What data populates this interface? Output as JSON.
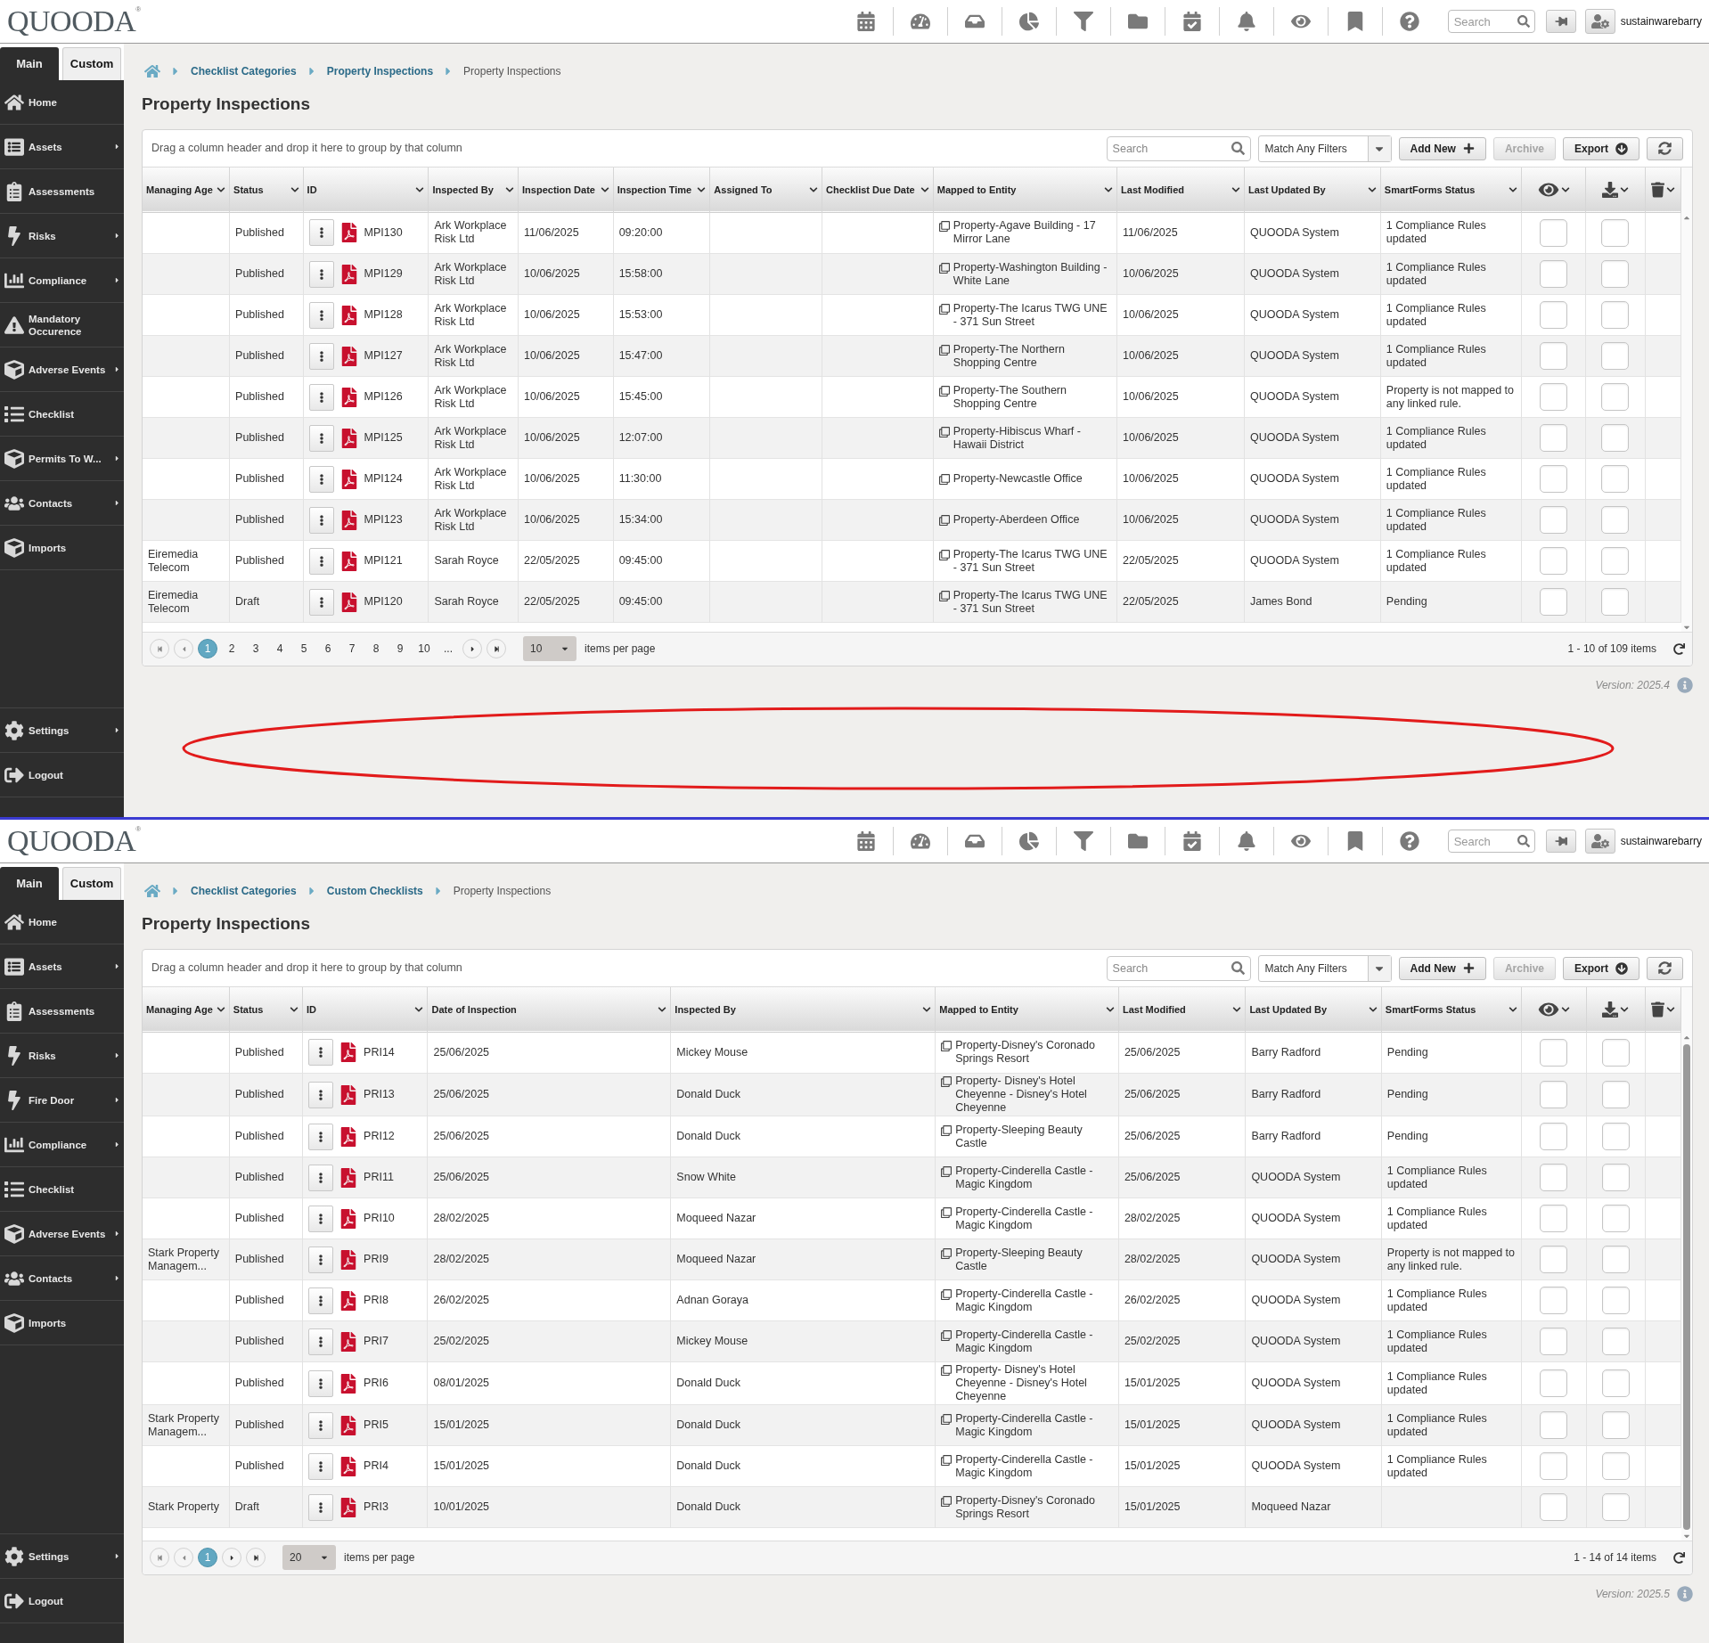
{
  "screens": [
    {
      "logo": "QUOODA",
      "logo_mark": "®",
      "top_search": {
        "placeholder": "Search"
      },
      "username": "sustainwarebarry",
      "sidebar_tabs": [
        {
          "label": "Main",
          "selected": true
        },
        {
          "label": "Custom",
          "selected": false
        }
      ],
      "menu": [
        {
          "label": "Home",
          "kind": "home",
          "submenu": false
        },
        {
          "label": "Assets",
          "kind": "card",
          "submenu": true
        },
        {
          "label": "Assessments",
          "kind": "clipboard",
          "submenu": false
        },
        {
          "label": "Risks",
          "kind": "bolt",
          "submenu": true
        },
        {
          "label": "Compliance",
          "kind": "chart",
          "submenu": true
        },
        {
          "label": "Mandatory Occurence",
          "kind": "warning",
          "submenu": false
        },
        {
          "label": "Adverse Events",
          "kind": "box",
          "submenu": true
        },
        {
          "label": "Checklist",
          "kind": "list",
          "submenu": false
        },
        {
          "label": "Permits To W...",
          "kind": "box",
          "submenu": true
        },
        {
          "label": "Contacts",
          "kind": "people",
          "submenu": true
        },
        {
          "label": "Imports",
          "kind": "box",
          "submenu": false
        }
      ],
      "bottom_menu": [
        {
          "label": "Settings",
          "kind": "gear",
          "submenu": true
        },
        {
          "label": "Logout",
          "kind": "exit",
          "submenu": false
        }
      ],
      "breadcrumb": [
        {
          "label": "Checklist Categories",
          "current": false
        },
        {
          "label": "Property Inspections",
          "current": false
        },
        {
          "label": "Property Inspections",
          "current": true
        }
      ],
      "title": "Property Inspections",
      "group_hint": "Drag a column header and drop it here to group by that column",
      "grid_search": {
        "placeholder": "Search"
      },
      "filter_select": {
        "value": "Match Any Filters"
      },
      "buttons": [
        {
          "label": "Add New",
          "kind": "add",
          "disabled": false
        },
        {
          "label": "Archive",
          "kind": "archive",
          "disabled": true
        },
        {
          "label": "Export",
          "kind": "export",
          "disabled": false
        },
        {
          "kind": "refresh",
          "disabled": false
        }
      ],
      "columns": [
        {
          "label": "Managing Age",
          "kind": "text"
        },
        {
          "label": "Status",
          "kind": "text"
        },
        {
          "label": "ID",
          "kind": "id"
        },
        {
          "label": "Inspected By",
          "kind": "text"
        },
        {
          "label": "Inspection Date",
          "kind": "text"
        },
        {
          "label": "Inspection Time",
          "kind": "text"
        },
        {
          "label": "Assigned To",
          "kind": "text"
        },
        {
          "label": "Checklist Due Date",
          "kind": "text"
        },
        {
          "label": "Mapped to Entity",
          "kind": "entity"
        },
        {
          "label": "Last Modified",
          "kind": "text"
        },
        {
          "label": "Last Updated By",
          "kind": "text"
        },
        {
          "label": "SmartForms Status",
          "kind": "text"
        },
        {
          "kind": "view"
        },
        {
          "kind": "download"
        },
        {
          "kind": "delete"
        }
      ],
      "rows": [
        {
          "status": "Published",
          "id": "MPI130",
          "inspected_by": "Ark Workplace Risk Ltd",
          "inspection_date": "11/06/2025",
          "inspection_time": "09:20:00",
          "mapped_to_entity": "Property-Agave Building - 17 Mirror Lane",
          "last_modified": "11/06/2025",
          "last_updated_by": "QUOODA System",
          "smartforms_status": "1 Compliance Rules updated",
          "view_checked": false,
          "download_checked": false
        },
        {
          "status": "Published",
          "id": "MPI129",
          "inspected_by": "Ark Workplace Risk Ltd",
          "inspection_date": "10/06/2025",
          "inspection_time": "15:58:00",
          "mapped_to_entity": "Property-Washington Building - White Lane",
          "last_modified": "10/06/2025",
          "last_updated_by": "QUOODA System",
          "smartforms_status": "1 Compliance Rules updated",
          "view_checked": false,
          "download_checked": false
        },
        {
          "status": "Published",
          "id": "MPI128",
          "inspected_by": "Ark Workplace Risk Ltd",
          "inspection_date": "10/06/2025",
          "inspection_time": "15:53:00",
          "mapped_to_entity": "Property-The Icarus TWG UNE - 371 Sun Street",
          "last_modified": "10/06/2025",
          "last_updated_by": "QUOODA System",
          "smartforms_status": "1 Compliance Rules updated",
          "view_checked": false,
          "download_checked": false
        },
        {
          "status": "Published",
          "id": "MPI127",
          "inspected_by": "Ark Workplace Risk Ltd",
          "inspection_date": "10/06/2025",
          "inspection_time": "15:47:00",
          "mapped_to_entity": "Property-The Northern Shopping Centre",
          "last_modified": "10/06/2025",
          "last_updated_by": "QUOODA System",
          "smartforms_status": "1 Compliance Rules updated",
          "view_checked": false,
          "download_checked": false
        },
        {
          "status": "Published",
          "id": "MPI126",
          "inspected_by": "Ark Workplace Risk Ltd",
          "inspection_date": "10/06/2025",
          "inspection_time": "15:45:00",
          "mapped_to_entity": "Property-The Southern Shopping Centre",
          "last_modified": "10/06/2025",
          "last_updated_by": "QUOODA System",
          "smartforms_status": "Property is not mapped to any linked rule.",
          "view_checked": false,
          "download_checked": false
        },
        {
          "status": "Published",
          "id": "MPI125",
          "inspected_by": "Ark Workplace Risk Ltd",
          "inspection_date": "10/06/2025",
          "inspection_time": "12:07:00",
          "mapped_to_entity": "Property-Hibiscus Wharf - Hawaii District",
          "last_modified": "10/06/2025",
          "last_updated_by": "QUOODA System",
          "smartforms_status": "1 Compliance Rules updated",
          "view_checked": false,
          "download_checked": false
        },
        {
          "status": "Published",
          "id": "MPI124",
          "inspected_by": "Ark Workplace Risk Ltd",
          "inspection_date": "10/06/2025",
          "inspection_time": "11:30:00",
          "mapped_to_entity": "Property-Newcastle Office",
          "last_modified": "10/06/2025",
          "last_updated_by": "QUOODA System",
          "smartforms_status": "1 Compliance Rules updated",
          "view_checked": false,
          "download_checked": false
        },
        {
          "status": "Published",
          "id": "MPI123",
          "inspected_by": "Ark Workplace Risk Ltd",
          "inspection_date": "10/06/2025",
          "inspection_time": "15:34:00",
          "mapped_to_entity": "Property-Aberdeen Office",
          "last_modified": "10/06/2025",
          "last_updated_by": "QUOODA System",
          "smartforms_status": "1 Compliance Rules updated",
          "view_checked": false,
          "download_checked": false
        },
        {
          "managing_agent": "Eiremedia Telecom",
          "status": "Published",
          "id": "MPI121",
          "inspected_by": "Sarah Royce",
          "inspection_date": "22/05/2025",
          "inspection_time": "09:45:00",
          "mapped_to_entity": "Property-The Icarus TWG UNE - 371 Sun Street",
          "last_modified": "22/05/2025",
          "last_updated_by": "QUOODA System",
          "smartforms_status": "1 Compliance Rules updated",
          "view_checked": false,
          "download_checked": false
        },
        {
          "managing_agent": "Eiremedia Telecom",
          "status": "Draft",
          "id": "MPI120",
          "inspected_by": "Sarah Royce",
          "inspection_date": "22/05/2025",
          "inspection_time": "09:45:00",
          "mapped_to_entity": "Property-The Icarus TWG UNE - 371 Sun Street",
          "last_modified": "22/05/2025",
          "last_updated_by": "James Bond",
          "smartforms_status": "Pending",
          "view_checked": false,
          "download_checked": false
        }
      ],
      "pager": {
        "pages": [
          {
            "label": "1",
            "selected": true
          },
          {
            "label": "2",
            "selected": false
          },
          {
            "label": "3",
            "selected": false
          },
          {
            "label": "4",
            "selected": false
          },
          {
            "label": "5",
            "selected": false
          },
          {
            "label": "6",
            "selected": false
          },
          {
            "label": "7",
            "selected": false
          },
          {
            "label": "8",
            "selected": false
          },
          {
            "label": "9",
            "selected": false
          },
          {
            "label": "10",
            "selected": false
          },
          {
            "label": "...",
            "selected": false
          }
        ],
        "page_size": "10",
        "page_size_label": "items per page",
        "summary": "1 - 10 of 109 items"
      },
      "version": "Version: 2025.4",
      "annotation": {
        "kind": "ellipse"
      }
    },
    {
      "logo": "QUOODA",
      "logo_mark": "®",
      "top_search": {
        "placeholder": "Search"
      },
      "username": "sustainwarebarry",
      "sidebar_tabs": [
        {
          "label": "Main",
          "selected": true
        },
        {
          "label": "Custom",
          "selected": false
        }
      ],
      "menu": [
        {
          "label": "Home",
          "kind": "home",
          "submenu": false
        },
        {
          "label": "Assets",
          "kind": "card",
          "submenu": true
        },
        {
          "label": "Assessments",
          "kind": "clipboard",
          "submenu": false
        },
        {
          "label": "Risks",
          "kind": "bolt",
          "submenu": true
        },
        {
          "label": "Fire Door",
          "kind": "bolt",
          "submenu": true
        },
        {
          "label": "Compliance",
          "kind": "chart",
          "submenu": true
        },
        {
          "label": "Checklist",
          "kind": "list",
          "submenu": false
        },
        {
          "label": "Adverse Events",
          "kind": "box",
          "submenu": true
        },
        {
          "label": "Contacts",
          "kind": "people",
          "submenu": true
        },
        {
          "label": "Imports",
          "kind": "box",
          "submenu": false
        }
      ],
      "bottom_menu": [
        {
          "label": "Settings",
          "kind": "gear",
          "submenu": true
        },
        {
          "label": "Logout",
          "kind": "exit",
          "submenu": false
        }
      ],
      "breadcrumb": [
        {
          "label": "Checklist Categories",
          "current": false
        },
        {
          "label": "Custom Checklists",
          "current": false
        },
        {
          "label": "Property Inspections",
          "current": true
        }
      ],
      "title": "Property Inspections",
      "group_hint": "Drag a column header and drop it here to group by that column",
      "grid_search": {
        "placeholder": "Search"
      },
      "filter_select": {
        "value": "Match Any Filters"
      },
      "buttons": [
        {
          "label": "Add New",
          "kind": "add",
          "disabled": false
        },
        {
          "label": "Archive",
          "kind": "archive",
          "disabled": true
        },
        {
          "label": "Export",
          "kind": "export",
          "disabled": false
        },
        {
          "kind": "refresh",
          "disabled": false
        }
      ],
      "columns": [
        {
          "label": "Managing Age",
          "kind": "text"
        },
        {
          "label": "Status",
          "kind": "text"
        },
        {
          "label": "ID",
          "kind": "id"
        },
        {
          "label": "Date of Inspection",
          "kind": "text"
        },
        {
          "label": "Inspected By",
          "kind": "text"
        },
        {
          "label": "Mapped to Entity",
          "kind": "entity"
        },
        {
          "label": "Last Modified",
          "kind": "text"
        },
        {
          "label": "Last Updated By",
          "kind": "text"
        },
        {
          "label": "SmartForms Status",
          "kind": "text"
        },
        {
          "kind": "view"
        },
        {
          "kind": "download"
        },
        {
          "kind": "delete"
        }
      ],
      "rows": [
        {
          "status": "Published",
          "id": "PRI14",
          "date_of_inspection": "25/06/2025",
          "inspected_by": "Mickey Mouse",
          "mapped_to_entity": "Property-Disney's Coronado Springs Resort",
          "last_modified": "25/06/2025",
          "last_updated_by": "Barry Radford",
          "smartforms_status": "Pending",
          "view_checked": false,
          "download_checked": false
        },
        {
          "status": "Published",
          "id": "PRI13",
          "date_of_inspection": "25/06/2025",
          "inspected_by": "Donald Duck",
          "mapped_to_entity": "Property- Disney's Hotel Cheyenne - Disney's Hotel Cheyenne",
          "last_modified": "25/06/2025",
          "last_updated_by": "Barry Radford",
          "smartforms_status": "Pending",
          "view_checked": false,
          "download_checked": false
        },
        {
          "status": "Published",
          "id": "PRI12",
          "date_of_inspection": "25/06/2025",
          "inspected_by": "Donald Duck",
          "mapped_to_entity": "Property-Sleeping Beauty Castle",
          "last_modified": "25/06/2025",
          "last_updated_by": "Barry Radford",
          "smartforms_status": "Pending",
          "view_checked": false,
          "download_checked": false
        },
        {
          "status": "Published",
          "id": "PRI11",
          "date_of_inspection": "25/06/2025",
          "inspected_by": "Snow White",
          "mapped_to_entity": "Property-Cinderella Castle - Magic Kingdom",
          "last_modified": "25/06/2025",
          "last_updated_by": "QUOODA System",
          "smartforms_status": "1 Compliance Rules updated",
          "view_checked": false,
          "download_checked": false
        },
        {
          "status": "Published",
          "id": "PRI10",
          "date_of_inspection": "28/02/2025",
          "inspected_by": "Moqueed Nazar",
          "mapped_to_entity": "Property-Cinderella Castle - Magic Kingdom",
          "last_modified": "28/02/2025",
          "last_updated_by": "QUOODA System",
          "smartforms_status": "1 Compliance Rules updated",
          "view_checked": false,
          "download_checked": false
        },
        {
          "managing_agent": "Stark Property Managem...",
          "status": "Published",
          "id": "PRI9",
          "date_of_inspection": "28/02/2025",
          "inspected_by": "Moqueed Nazar",
          "mapped_to_entity": "Property-Sleeping Beauty Castle",
          "last_modified": "28/02/2025",
          "last_updated_by": "QUOODA System",
          "smartforms_status": "Property is not mapped to any linked rule.",
          "view_checked": false,
          "download_checked": false
        },
        {
          "status": "Published",
          "id": "PRI8",
          "date_of_inspection": "26/02/2025",
          "inspected_by": "Adnan Goraya",
          "mapped_to_entity": "Property-Cinderella Castle - Magic Kingdom",
          "last_modified": "26/02/2025",
          "last_updated_by": "QUOODA System",
          "smartforms_status": "1 Compliance Rules updated",
          "view_checked": false,
          "download_checked": false
        },
        {
          "status": "Published",
          "id": "PRI7",
          "date_of_inspection": "25/02/2025",
          "inspected_by": "Mickey Mouse",
          "mapped_to_entity": "Property-Cinderella Castle - Magic Kingdom",
          "last_modified": "25/02/2025",
          "last_updated_by": "QUOODA System",
          "smartforms_status": "1 Compliance Rules updated",
          "view_checked": false,
          "download_checked": false
        },
        {
          "status": "Published",
          "id": "PRI6",
          "date_of_inspection": "08/01/2025",
          "inspected_by": "Donald Duck",
          "mapped_to_entity": "Property- Disney's Hotel Cheyenne - Disney's Hotel Cheyenne",
          "last_modified": "15/01/2025",
          "last_updated_by": "QUOODA System",
          "smartforms_status": "1 Compliance Rules updated",
          "view_checked": false,
          "download_checked": false
        },
        {
          "managing_agent": "Stark Property Managem...",
          "status": "Published",
          "id": "PRI5",
          "date_of_inspection": "15/01/2025",
          "inspected_by": "Donald Duck",
          "mapped_to_entity": "Property-Cinderella Castle - Magic Kingdom",
          "last_modified": "15/01/2025",
          "last_updated_by": "QUOODA System",
          "smartforms_status": "1 Compliance Rules updated",
          "view_checked": false,
          "download_checked": false
        },
        {
          "status": "Published",
          "id": "PRI4",
          "date_of_inspection": "15/01/2025",
          "inspected_by": "Donald Duck",
          "mapped_to_entity": "Property-Cinderella Castle - Magic Kingdom",
          "last_modified": "15/01/2025",
          "last_updated_by": "QUOODA System",
          "smartforms_status": "1 Compliance Rules updated",
          "view_checked": false,
          "download_checked": false
        },
        {
          "managing_agent": "Stark Property",
          "status": "Draft",
          "id": "PRI3",
          "date_of_inspection": "10/01/2025",
          "inspected_by": "Donald Duck",
          "mapped_to_entity": "Property-Disney's Coronado Springs Resort",
          "last_modified": "15/01/2025",
          "last_updated_by": "Moqueed Nazar",
          "view_checked": false,
          "download_checked": false
        }
      ],
      "pager": {
        "pages": [
          {
            "label": "1",
            "selected": true
          }
        ],
        "page_size": "20",
        "page_size_label": "items per page",
        "summary": "1 - 14 of 14 items"
      },
      "version": "Version: 2025.5"
    }
  ]
}
